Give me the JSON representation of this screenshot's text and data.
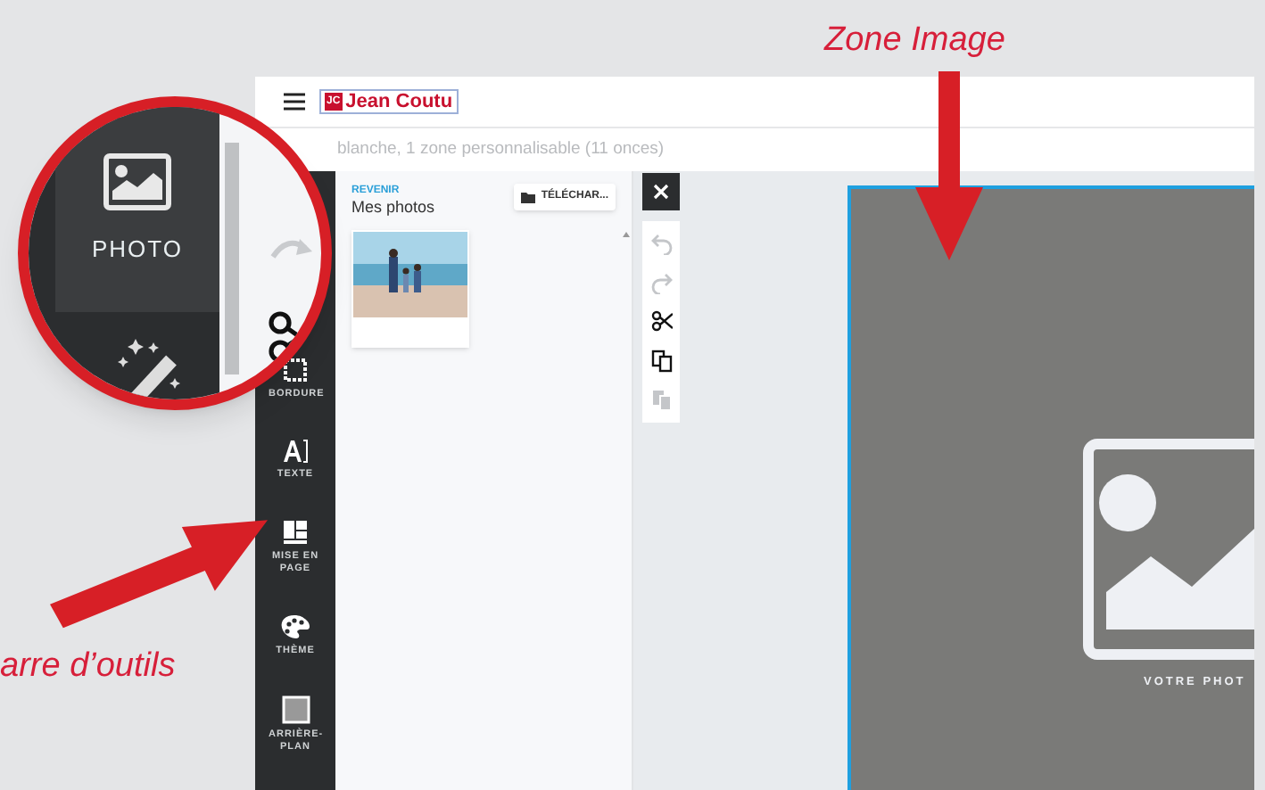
{
  "annotations": [
    {
      "kind": "top",
      "text": "Zone Image"
    },
    {
      "kind": "left",
      "text": "arre d’outils"
    }
  ],
  "header": {
    "logo_mark": "JC",
    "logo": "Jean Coutu"
  },
  "subtitle": "blanche, 1 zone personnalisable (11 onces)",
  "magnifier": {
    "label": "PHOTO"
  },
  "toolbar": [
    {
      "kind": "border",
      "label": "BORDURE"
    },
    {
      "kind": "text",
      "label": "TEXTE"
    },
    {
      "kind": "layout",
      "label": "MISE EN PAGE"
    },
    {
      "kind": "theme",
      "label": "THÈME"
    },
    {
      "kind": "background",
      "label": "ARRIÈRE-PLAN"
    }
  ],
  "panel": {
    "back": "REVENIR",
    "title": "Mes photos",
    "upload": "TÉLÉCHAR..."
  },
  "edit_tools": [
    {
      "kind": "undo",
      "disabled": true
    },
    {
      "kind": "redo",
      "disabled": true
    },
    {
      "kind": "cut",
      "disabled": false
    },
    {
      "kind": "copy",
      "disabled": false
    },
    {
      "kind": "paste",
      "disabled": true
    }
  ],
  "canvas": {
    "placeholder": "VOTRE PHOT"
  }
}
